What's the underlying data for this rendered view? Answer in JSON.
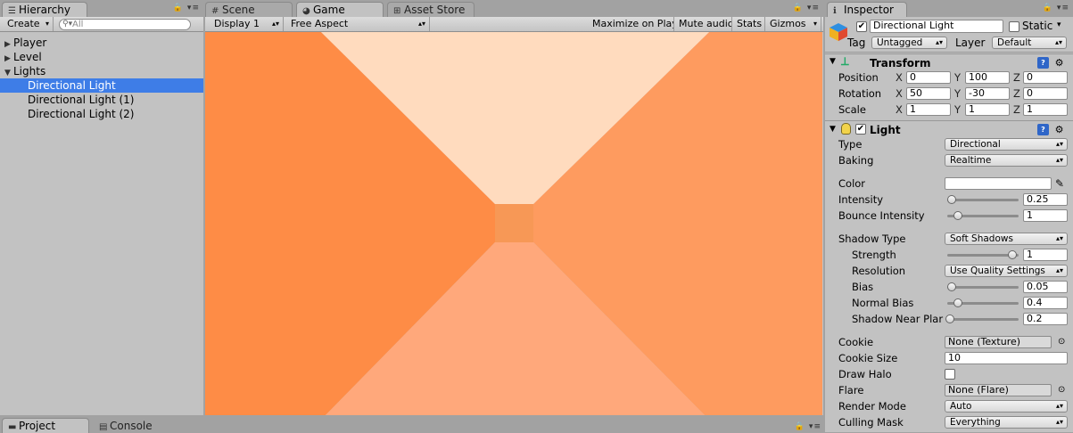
{
  "hierarchy": {
    "tab": "Hierarchy",
    "create_label": "Create",
    "search_placeholder": "All",
    "items": [
      {
        "label": "Player",
        "arrow": "▶"
      },
      {
        "label": "Level",
        "arrow": "▶"
      },
      {
        "label": "Lights",
        "arrow": "▼"
      },
      {
        "label": "Directional Light"
      },
      {
        "label": "Directional Light (1)"
      },
      {
        "label": "Directional Light (2)"
      }
    ]
  },
  "center_tabs": {
    "scene": "Scene",
    "game": "Game",
    "asset_store": "Asset Store"
  },
  "game_toolbar": {
    "display": "Display 1",
    "aspect": "Free Aspect",
    "maximize": "Maximize on Play",
    "mute": "Mute audio",
    "stats": "Stats",
    "gizmos": "Gizmos"
  },
  "game_view_colors": {
    "left": "#fe8c46",
    "right": "#fe9b5f",
    "top": "#ffdbbe",
    "bottom": "#ffa87b",
    "center": "#f79856"
  },
  "bottom_tabs": {
    "project": "Project",
    "console": "Console"
  },
  "inspector": {
    "tab": "Inspector",
    "object_name": "Directional Light",
    "static_label": "Static",
    "tag_label": "Tag",
    "tag_value": "Untagged",
    "layer_label": "Layer",
    "layer_value": "Default",
    "transform": {
      "title": "Transform",
      "position": {
        "label": "Position",
        "x": "0",
        "y": "100",
        "z": "0"
      },
      "rotation": {
        "label": "Rotation",
        "x": "50",
        "y": "-30",
        "z": "0"
      },
      "scale": {
        "label": "Scale",
        "x": "1",
        "y": "1",
        "z": "1"
      }
    },
    "light": {
      "title": "Light",
      "type_label": "Type",
      "type_value": "Directional",
      "baking_label": "Baking",
      "baking_value": "Realtime",
      "color_label": "Color",
      "color_value": "#ffffff",
      "intensity_label": "Intensity",
      "intensity_value": "0.25",
      "intensity_fraction": 0.03,
      "bounce_label": "Bounce Intensity",
      "bounce_value": "1",
      "bounce_fraction": 0.125,
      "shadow_type_label": "Shadow Type",
      "shadow_type_value": "Soft Shadows",
      "strength_label": "Strength",
      "strength_value": "1",
      "strength_fraction": 1,
      "resolution_label": "Resolution",
      "resolution_value": "Use Quality Settings",
      "bias_label": "Bias",
      "bias_value": "0.05",
      "bias_fraction": 0.025,
      "normal_bias_label": "Normal Bias",
      "normal_bias_value": "0.4",
      "normal_bias_fraction": 0.13,
      "near_plane_label": "Shadow Near Plar",
      "near_plane_value": "0.2",
      "near_plane_fraction": 0,
      "cookie_label": "Cookie",
      "cookie_value": "None (Texture)",
      "cookie_size_label": "Cookie Size",
      "cookie_size_value": "10",
      "draw_halo_label": "Draw Halo",
      "flare_label": "Flare",
      "flare_value": "None (Flare)",
      "render_mode_label": "Render Mode",
      "render_mode_value": "Auto",
      "culling_mask_label": "Culling Mask",
      "culling_mask_value": "Everything"
    }
  }
}
